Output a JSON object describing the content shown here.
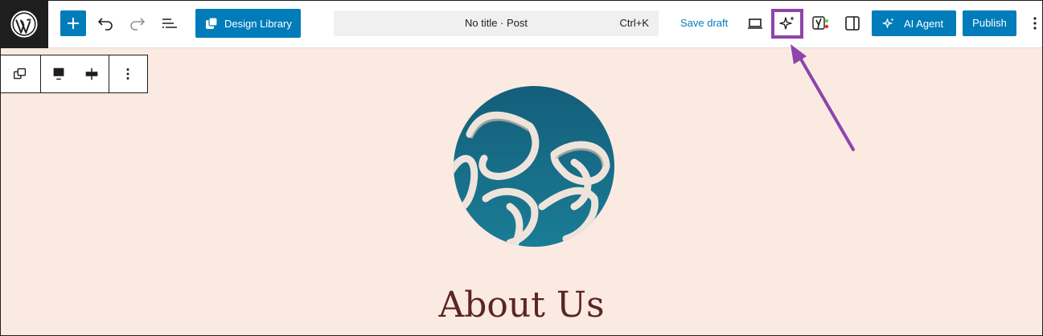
{
  "toolbar": {
    "logo_icon": "wordpress-logo-icon",
    "add_block_icon": "plus-icon",
    "undo_icon": "undo-icon",
    "redo_icon": "redo-icon",
    "list_view_icon": "document-overview-icon",
    "design_library_label": "Design Library",
    "command_bar_title": "No title · Post",
    "command_bar_shortcut": "Ctrl+K",
    "save_draft_label": "Save draft",
    "preview_icon": "laptop-icon",
    "ai_sparkle_icon": "sparkle-icon",
    "yoast_icon": "yoast-seo-icon",
    "settings_icon": "sidebar-toggle-icon",
    "ai_agent_label": "AI Agent",
    "publish_label": "Publish",
    "more_icon": "vertical-ellipsis-icon"
  },
  "block_toolbar": {
    "transform_icon": "transform-block-icon",
    "align_top_icon": "align-top-icon",
    "justify_center_icon": "justify-center-icon",
    "options_icon": "vertical-ellipsis-icon"
  },
  "canvas": {
    "heading": "About Us",
    "image_icon": "abstract-sculpture-image"
  },
  "colors": {
    "wp_blue": "#007cba",
    "canvas_bg": "#fbeae1",
    "heading": "#5b2525",
    "highlight": "#8e44ad"
  }
}
